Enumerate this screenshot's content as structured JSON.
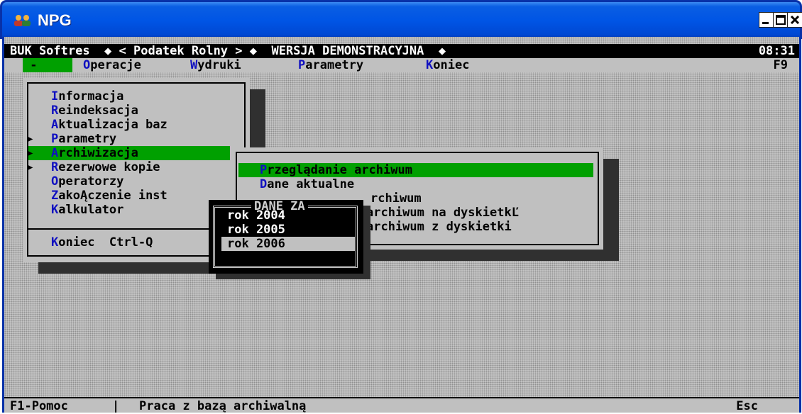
{
  "window": {
    "title": "NPG",
    "icon": "users-icon"
  },
  "topbar": {
    "left": "BUK Softres  ◆ < Podatek Rolny > ◆  WERSJA DEMONSTRACYJNA  ◆",
    "clock": "08:31"
  },
  "menubar": {
    "dash": " - ",
    "operacje_hk": "O",
    "operacje_rest": "peracje",
    "wydruki_hk": "W",
    "wydruki_rest": "ydruki",
    "parametry_hk": "P",
    "parametry_rest": "arametry",
    "koniec_hk": "K",
    "koniec_rest": "oniec",
    "f9": "F9"
  },
  "main_menu": {
    "items": [
      {
        "hk": "I",
        "rest": "nformacja"
      },
      {
        "hk": "R",
        "rest": "eindeksacja"
      },
      {
        "hk": "A",
        "rest": "ktualizacja baz"
      },
      {
        "hk": "P",
        "rest": "arametry"
      },
      {
        "hk": "A",
        "rest": "rchiwizacja"
      },
      {
        "hk": "R",
        "rest": "ezerwowe kopie"
      },
      {
        "hk": "O",
        "rest": "peratorzy"
      },
      {
        "hk": "Z",
        "rest": "akoĄczenie inst"
      },
      {
        "hk": "K",
        "rest": "alkulator"
      }
    ],
    "exit_hk": "K",
    "exit_rest": "oniec  Ctrl-Q",
    "selected": "Archiwizacja"
  },
  "archive_menu": {
    "items": [
      {
        "hk": "P",
        "rest": "rzeglądanie archiwum"
      },
      {
        "hk": "D",
        "rest": "ane aktualne"
      },
      {
        "hk": "",
        "rest": "rchiwum"
      },
      {
        "hk": "",
        "rest": "archiwum na dyskietkĽ"
      },
      {
        "hk": "",
        "rest": "archiwum z dyskietki"
      }
    ]
  },
  "dane_za": {
    "title": "DANE ZA",
    "years": [
      "rok 2004",
      "rok 2005",
      "rok 2006"
    ],
    "current": "rok 2006"
  },
  "statusbar": {
    "help": "F1-Pomoc",
    "sep": "|",
    "message": "Praca z bazą archiwalną",
    "esc": "Esc"
  }
}
